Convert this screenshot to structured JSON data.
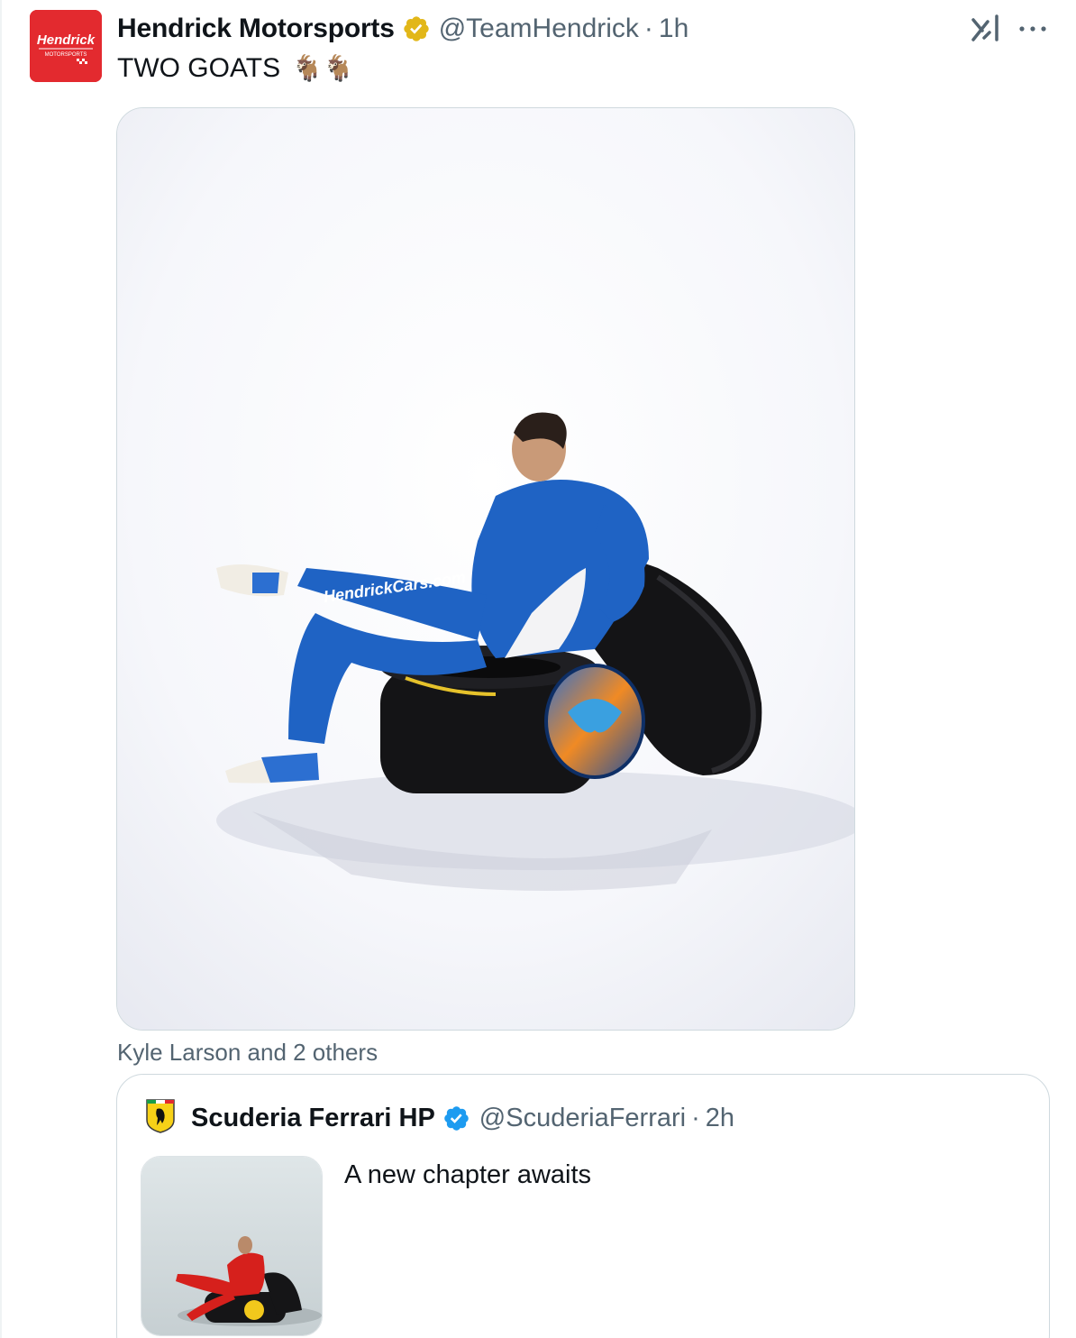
{
  "tweet": {
    "author_name": "Hendrick Motorsports",
    "author_handle": "@TeamHendrick",
    "separator": "·",
    "time": "1h",
    "text": "TWO GOATS",
    "emojis": "🐐🐐",
    "avatar_text": "Hendrick",
    "avatar_subtext": "MOTORSPORTS",
    "tagged_people": "Kyle Larson and 2 others",
    "more_label": "···"
  },
  "quoted_tweet": {
    "author_name": "Scuderia Ferrari HP",
    "author_handle": "@ScuderiaFerrari",
    "separator": "·",
    "time": "2h",
    "text": "A new chapter awaits"
  },
  "icons": {
    "verified_gold": "verified-gold-badge",
    "verified_blue": "verified-blue-badge",
    "grok": "grok-icon",
    "more": "more-icon"
  },
  "colors": {
    "hendrick_red": "#e32a2f",
    "verified_gold": "#e2b719",
    "verified_blue": "#1d9bf0",
    "suit_blue": "#1f63c4",
    "text_secondary": "#536471",
    "border": "#cfd9de"
  }
}
